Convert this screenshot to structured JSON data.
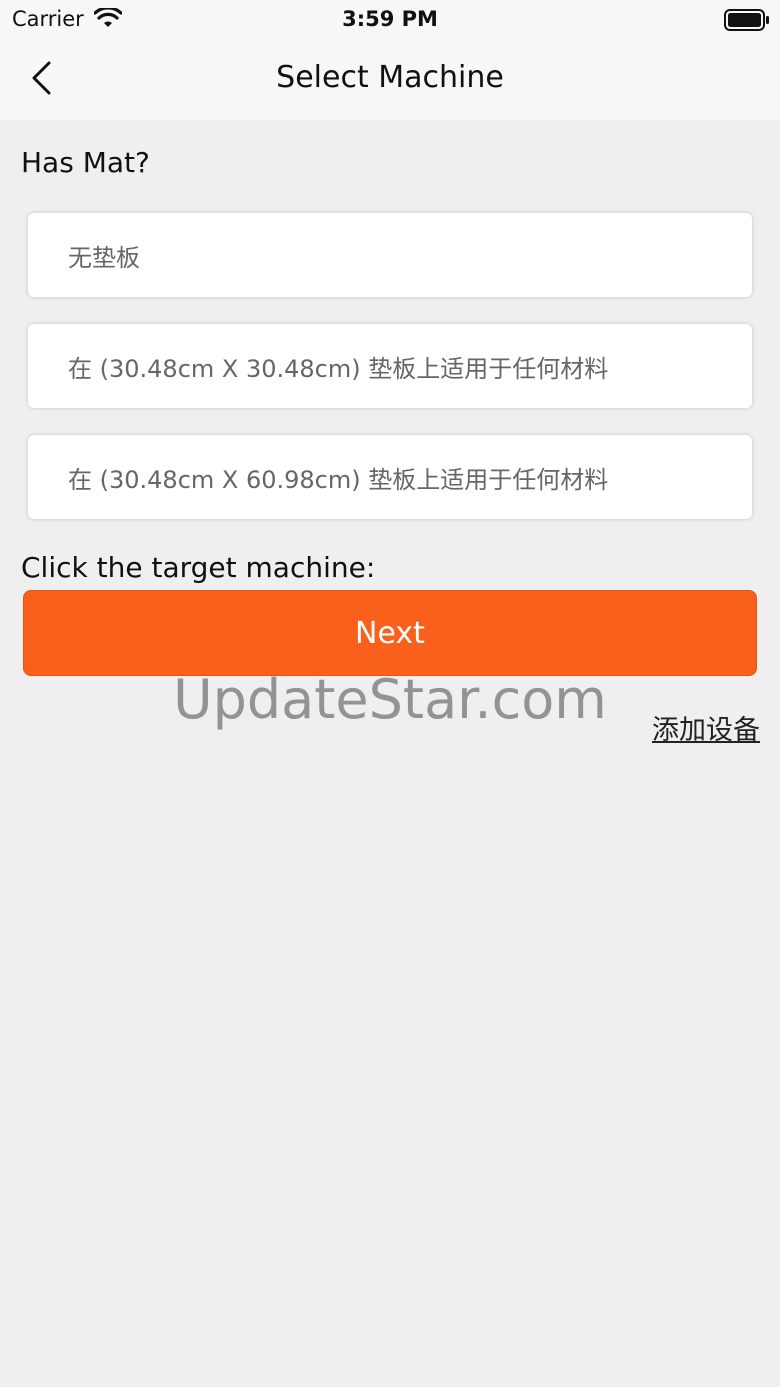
{
  "status_bar": {
    "carrier": "Carrier",
    "time": "3:59 PM"
  },
  "nav": {
    "title": "Select Machine",
    "back_icon": "chevron-left-icon"
  },
  "mat_section": {
    "label": "Has Mat?",
    "options": [
      "无垫板",
      "在 (30.48cm X 30.48cm) 垫板上适用于任何材料",
      "在 (30.48cm X 60.98cm) 垫板上适用于任何材料"
    ]
  },
  "machine_section": {
    "label": "Click the target machine:"
  },
  "next_button": "Next",
  "watermark": "UpdateStar.com",
  "add_device_link": "添加设备",
  "colors": {
    "accent": "#f8601c",
    "background": "#efefef"
  }
}
